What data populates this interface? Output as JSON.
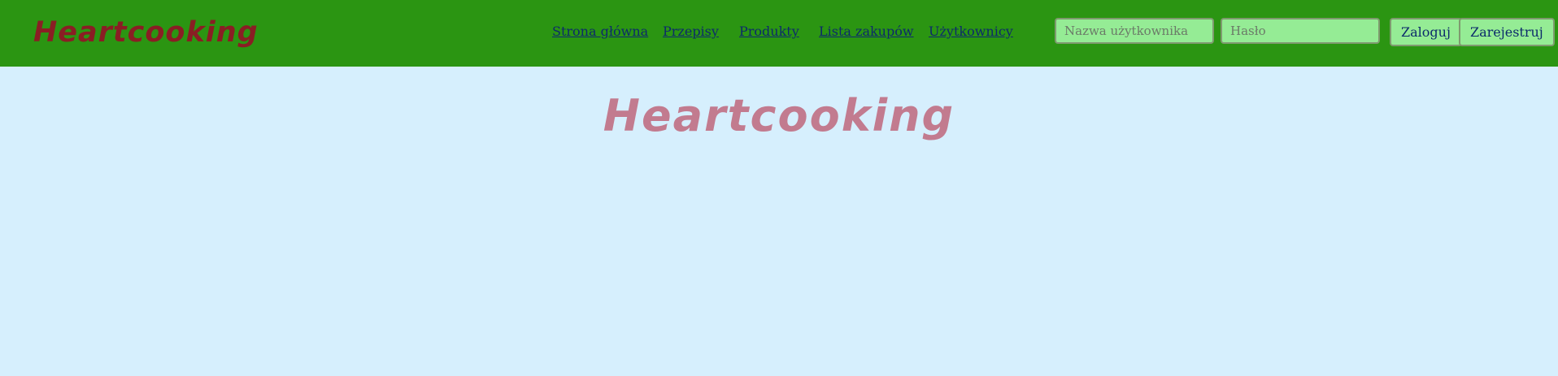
{
  "header": {
    "brand": "Heartcooking",
    "nav": [
      {
        "label": "Strona główna"
      },
      {
        "label": "Przepisy"
      },
      {
        "label": "Produkty"
      },
      {
        "label": "Lista zakupów"
      },
      {
        "label": "Użytkownicy"
      }
    ],
    "login": {
      "username_placeholder": "Nazwa użytkownika",
      "password_placeholder": "Hasło",
      "login_label": "Zaloguj",
      "register_label": "Zarejestruj"
    }
  },
  "main": {
    "title": "Heartcooking"
  },
  "colors": {
    "header_bg": "#2b9512",
    "page_bg": "#d6effd",
    "brand": "#8a1e24",
    "hero_title": "#c27b8f",
    "link": "#0c2a6b",
    "input_bg": "#95ec95"
  }
}
